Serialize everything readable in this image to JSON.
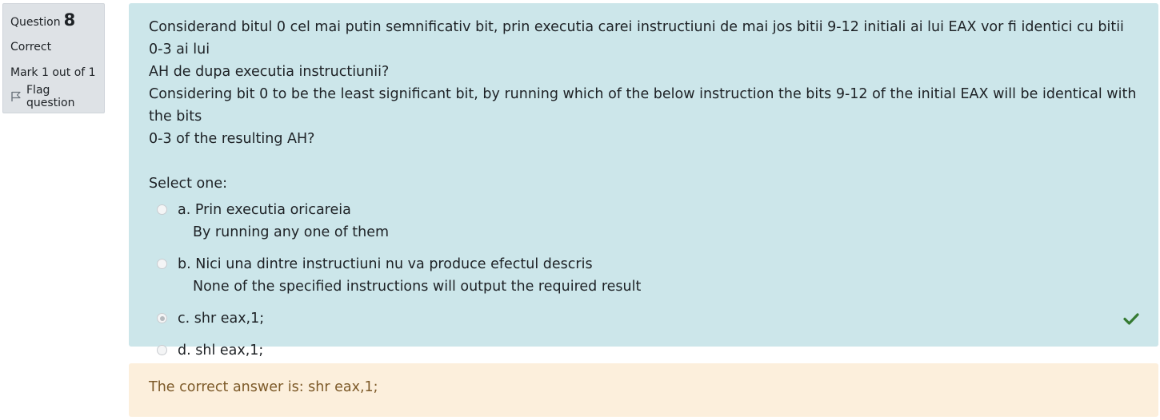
{
  "info": {
    "question_label": "Question",
    "question_number": "8",
    "state": "Correct",
    "grade": "Mark 1 out of 1",
    "flag_label": "Flag question"
  },
  "question": {
    "text_ro_line1": "Considerand bitul 0 cel mai putin semnificativ bit, prin executia carei instructiuni de mai jos bitii 9-12 initiali ai lui EAX vor fi identici cu bitii 0-3 ai lui",
    "text_ro_line2": "AH de dupa executia instructiunii?",
    "text_en_line1": "Considering bit 0 to be the least significant bit, by running which of the below instruction the bits 9-12 of the initial EAX will be identical with the bits",
    "text_en_line2": "0-3 of the resulting AH?",
    "select_prompt": "Select one:"
  },
  "options": [
    {
      "label": "a. Prin executia oricareia",
      "sub": "By running any one of them",
      "selected": false,
      "correct": false
    },
    {
      "label": "b. Nici una dintre instructiuni nu va produce efectul descris",
      "sub": "None of the specified instructions will output the required result",
      "selected": false,
      "correct": false
    },
    {
      "label": "c. shr eax,1;",
      "sub": "",
      "selected": true,
      "correct": true
    },
    {
      "label": "d. shl eax,1;",
      "sub": "",
      "selected": false,
      "correct": false
    }
  ],
  "feedback": {
    "right_answer": "The correct answer is: shr eax,1;"
  },
  "colors": {
    "formulation_bg": "#cce6ea",
    "feedback_bg": "#fcefdc",
    "feedback_text": "#7d5a29",
    "correct_check": "#357a32"
  }
}
